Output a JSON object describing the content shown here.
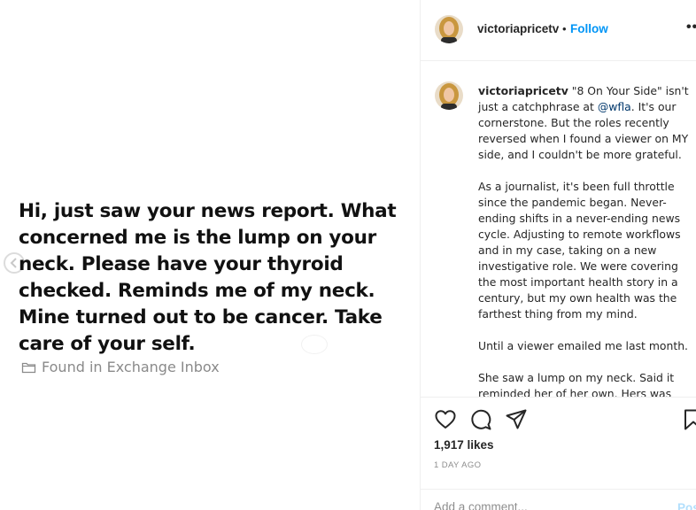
{
  "media": {
    "message": "Hi, just saw your news report. What\nconcerned me is the lump on your\nneck. Please have your thyroid\nchecked. Reminds me of my neck.\nMine turned out to be cancer. Take\ncare of your self.",
    "found_label": "Found in Exchange Inbox"
  },
  "header": {
    "username": "victoriapricetv",
    "separator": "•",
    "follow_label": "Follow",
    "more_label": "••"
  },
  "caption": {
    "username": "victoriapricetv",
    "p1_before": " \"8 On Your Side\" isn't just a catchphrase at ",
    "mention": "@wfla",
    "p1_after": ". It's our cornerstone. But the roles recently reversed when I found a viewer on MY side, and I couldn't be more grateful.",
    "p2": "As a journalist, it's been full throttle since the pandemic began. Never-ending shifts in a never-ending news cycle. Adjusting to remote workflows and in my case, taking on a new investigative role. We were covering the most important health story in a century, but my own health was the farthest thing from my mind.",
    "p3": "Until a viewer emailed me last month.",
    "p4": "She saw a lump on my neck. Said it reminded her of her own. Hers was cancer."
  },
  "actions": {
    "icons": [
      "heart-icon",
      "comment-icon",
      "share-icon",
      "bookmark-icon"
    ],
    "likes": "1,917 likes",
    "time": "1 DAY AGO",
    "comment_placeholder": "Add a comment...",
    "post_label": "Post"
  },
  "colors": {
    "follow": "#0095f6",
    "mention": "#00376b",
    "post_disabled": "#b2dffc",
    "muted": "#8e8e8e"
  }
}
